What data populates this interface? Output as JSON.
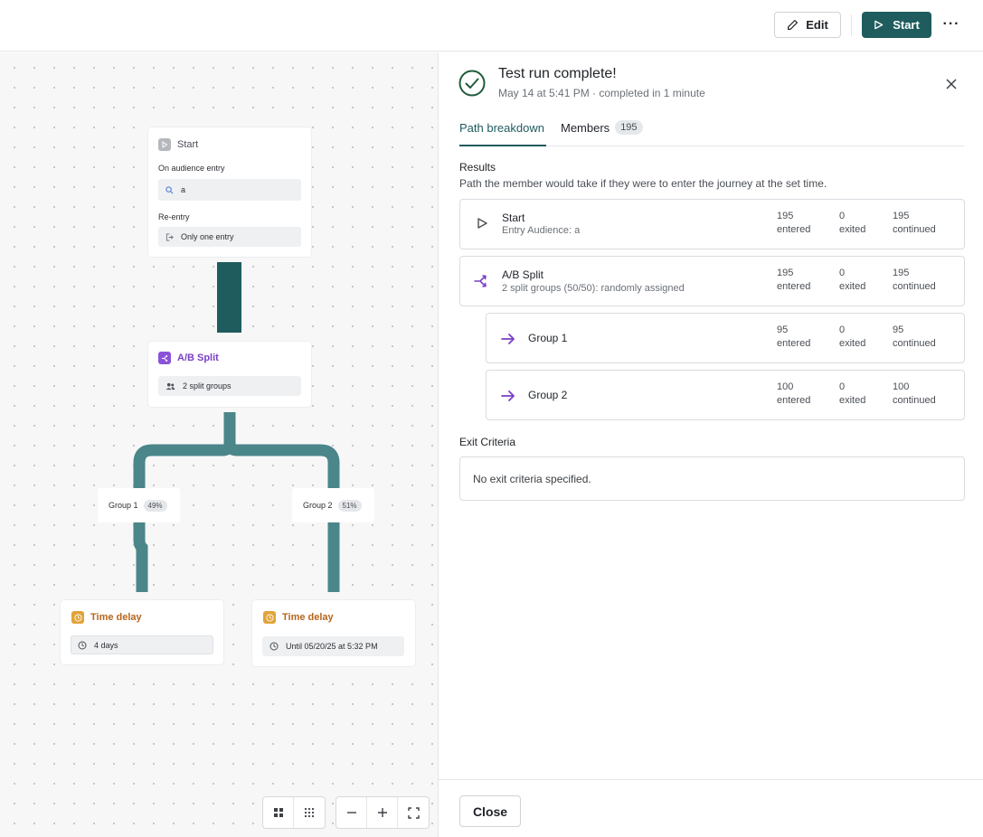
{
  "toolbar": {
    "edit_label": "Edit",
    "start_label": "Start",
    "more_label": "···"
  },
  "canvas": {
    "start_node": {
      "title": "Start",
      "entry_label": "On audience entry",
      "audience_value": "a",
      "reentry_label": "Re-entry",
      "reentry_value": "Only one entry"
    },
    "split_node": {
      "title": "A/B Split",
      "groups_value": "2 split groups"
    },
    "branches": [
      {
        "label": "Group 1",
        "percent": "49%"
      },
      {
        "label": "Group 2",
        "percent": "51%"
      }
    ],
    "delay_nodes": [
      {
        "title": "Time delay",
        "value": "4 days"
      },
      {
        "title": "Time delay",
        "value": "Until 05/20/25 at 5:32 PM"
      }
    ]
  },
  "panel": {
    "title": "Test run complete!",
    "subtitle": "May 14 at 5:41 PM · completed in 1 minute",
    "tabs": [
      {
        "label": "Path breakdown"
      },
      {
        "label": "Members",
        "count": "195"
      }
    ],
    "results_title": "Results",
    "results_desc": "Path the member would take if they were to enter the journey at the set time.",
    "steps": [
      {
        "name": "Start",
        "sub": "Entry Audience: a",
        "entered": "195",
        "exited": "0",
        "continued": "195"
      },
      {
        "name": "A/B Split",
        "sub": "2 split groups (50/50): randomly assigned",
        "entered": "195",
        "exited": "0",
        "continued": "195"
      },
      {
        "name": "Group 1",
        "sub": "",
        "entered": "95",
        "exited": "0",
        "continued": "95"
      },
      {
        "name": "Group 2",
        "sub": "",
        "entered": "100",
        "exited": "0",
        "continued": "100"
      }
    ],
    "stat_labels": {
      "entered": "entered",
      "exited": "exited",
      "continued": "continued"
    },
    "exit_title": "Exit Criteria",
    "exit_value": "No exit criteria specified.",
    "close_label": "Close"
  },
  "colors": {
    "brand": "#1f5c5e",
    "connector": "#4a868a",
    "purple": "#7a3fc6",
    "orange": "#b5651d",
    "success": "#1f5c3c"
  }
}
